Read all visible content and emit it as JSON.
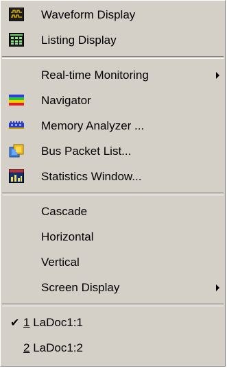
{
  "menu": {
    "section_views": [
      {
        "label": "Waveform Display",
        "icon": "waveform-display-icon"
      },
      {
        "label": "Listing Display",
        "icon": "listing-display-icon"
      }
    ],
    "section_tools": [
      {
        "label": "Real-time Monitoring",
        "has_submenu": true
      },
      {
        "label": "Navigator",
        "icon": "navigator-icon"
      },
      {
        "label": "Memory Analyzer ...",
        "icon": "memory-analyzer-icon"
      },
      {
        "label": "Bus Packet List...",
        "icon": "bus-packet-list-icon"
      },
      {
        "label": "Statistics Window...",
        "icon": "statistics-window-icon"
      }
    ],
    "section_window": [
      {
        "label": "Cascade"
      },
      {
        "label": "Horizontal"
      },
      {
        "label": "Vertical"
      },
      {
        "label": "Screen Display",
        "has_submenu": true
      }
    ],
    "section_docs": [
      {
        "number": "1",
        "label": " LaDoc1:1",
        "checked": true
      },
      {
        "number": "2",
        "label": " LaDoc1:2",
        "checked": false
      }
    ]
  }
}
